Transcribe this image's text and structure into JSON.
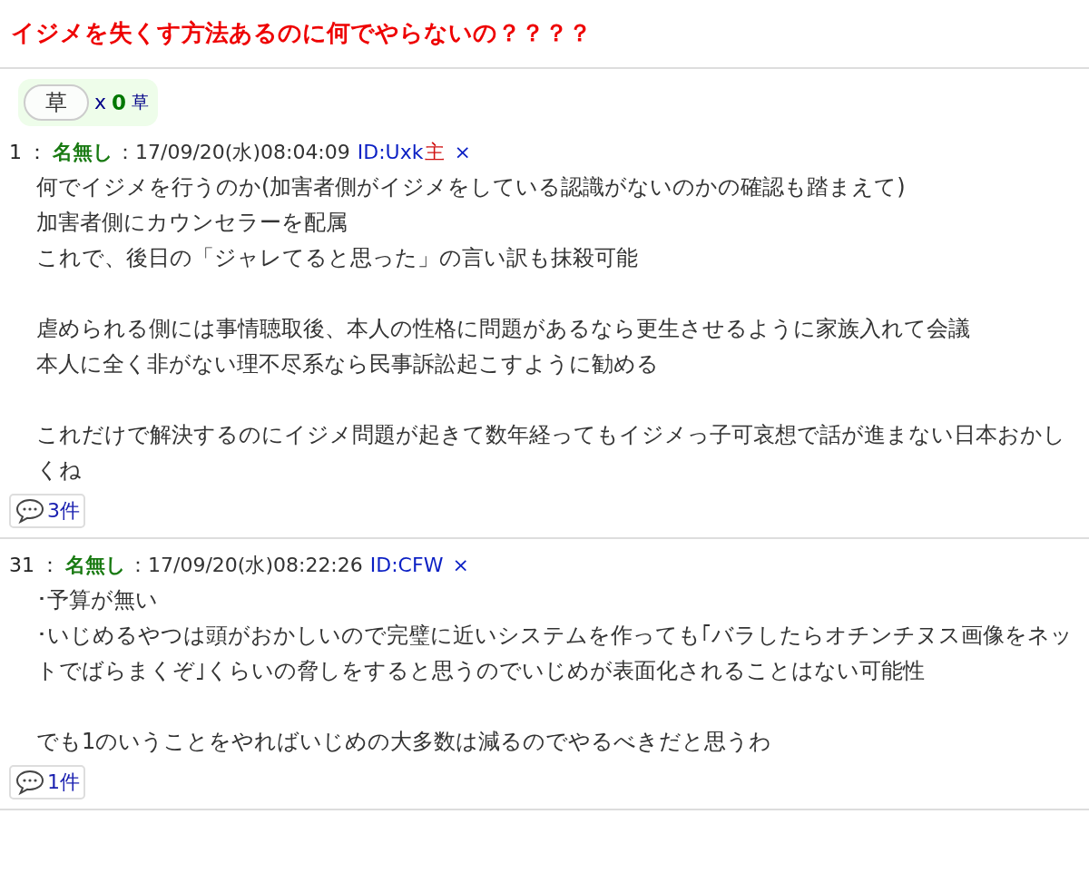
{
  "title": "イジメを失くす方法あるのに何でやらないの？？？？",
  "reaction": {
    "button": "草",
    "prefix": "x",
    "count": "0",
    "unit": "草"
  },
  "posts": [
    {
      "number": "1",
      "separator": "：",
      "name": "名無し",
      "date": "：17/09/20(水)08:04:09",
      "id": "ID:Uxk",
      "owner_mark": "主",
      "close": "×",
      "paragraphs": [
        [
          "何でイジメを行うのか(加害者側がイジメをしている認識がないのかの確認も踏まえて)",
          "加害者側にカウンセラーを配属",
          "これで、後日の「ジャレてると思った」の言い訳も抹殺可能"
        ],
        [
          "虐められる側には事情聴取後、本人の性格に問題があるなら更生させるように家族入れて会議",
          "本人に全く非がない理不尽系なら民事訴訟起こすように勧める"
        ],
        [
          "これだけで解決するのにイジメ問題が起きて数年経ってもイジメっ子可哀想で話が進まない日本おかしくね"
        ]
      ],
      "replies": "3件"
    },
    {
      "number": "31",
      "separator": "： ",
      "name": "名無し",
      "date": "：17/09/20(水)08:22:26",
      "id": "ID:CFW",
      "close": "×",
      "paragraphs": [
        [
          "･予算が無い",
          "･いじめるやつは頭がおかしいので完璧に近いシステムを作っても｢バラしたらオチンチヌス画像をネットでばらまくぞ｣くらいの脅しをすると思うのでいじめが表面化されることはない可能性"
        ],
        [
          "でも1のいうことをやればいじめの大多数は減るのでやるべきだと思うわ"
        ]
      ],
      "replies": "1件"
    }
  ]
}
